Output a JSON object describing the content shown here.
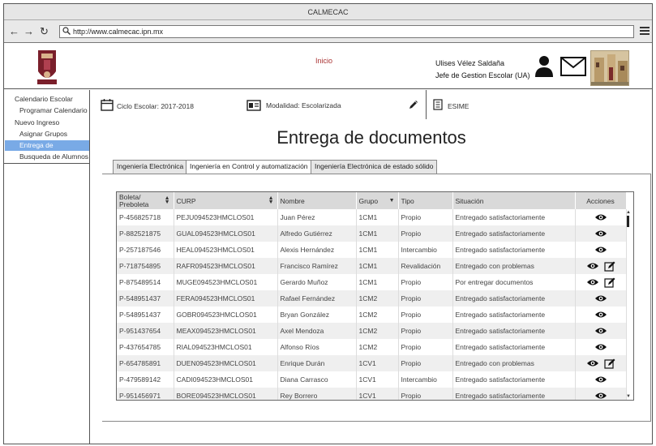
{
  "window": {
    "title": "CALMECAC"
  },
  "browser": {
    "url": "http://www.calmecac.ipn.mx"
  },
  "header": {
    "home_link": "Inicio",
    "user_name": "Ulises Vélez Saldaña",
    "user_role": "Jefe de Gestion Escolar (UA)"
  },
  "sidebar": {
    "items": [
      {
        "label": "Calendario Escolar",
        "active": false
      },
      {
        "label": "Programar Calendario",
        "active": false
      },
      {
        "label": "Nuevo Ingreso",
        "active": false
      },
      {
        "label": "Asignar Grupos",
        "active": false
      },
      {
        "label": "Entrega de",
        "active": true
      },
      {
        "label": "Busqueda de Alumnos",
        "active": false
      }
    ]
  },
  "info": {
    "ciclo": "Ciclo Escolar: 2017-2018",
    "modalidad": "Modalidad: Escolarizada",
    "escuela": "ESIME"
  },
  "page_title": "Entrega de documentos",
  "tabs": [
    {
      "label": "Ingeniería Electrónica",
      "active": false
    },
    {
      "label": "Ingeniería en Control y automatización",
      "active": true
    },
    {
      "label": "Ingeniería Electrónica de estado sólido",
      "active": false
    }
  ],
  "table": {
    "headers": [
      "Boleta/ Preboleta",
      "CURP",
      "Nombre",
      "Grupo",
      "Tipo",
      "Situación",
      "Acciones"
    ],
    "rows": [
      {
        "boleta": "P-456825718",
        "curp": "PEJU094523HMCLOS01",
        "nombre": "Juan Pérez",
        "grupo": "1CM1",
        "tipo": "Propio",
        "situacion": "Entregado satisfactoriamente",
        "edit": false
      },
      {
        "boleta": "P-882521875",
        "curp": "GUAL094523HMCLOS01",
        "nombre": "Alfredo Gutiérrez",
        "grupo": "1CM1",
        "tipo": "Propio",
        "situacion": "Entregado satisfactoriamente",
        "edit": false
      },
      {
        "boleta": "P-257187546",
        "curp": "HEAL094523HMCLOS01",
        "nombre": "Alexis Hernández",
        "grupo": "1CM1",
        "tipo": "Intercambio",
        "situacion": "Entregado satisfactoriamente",
        "edit": false
      },
      {
        "boleta": "P-718754895",
        "curp": "RAFR094523HMCLOS01",
        "nombre": "Francisco Ramírez",
        "grupo": "1CM1",
        "tipo": "Revalidación",
        "situacion": "Entregado con problemas",
        "edit": true
      },
      {
        "boleta": "P-875489514",
        "curp": "MUGE094523HMCLOS01",
        "nombre": "Gerardo Muñoz",
        "grupo": "1CM1",
        "tipo": "Propio",
        "situacion": "Por entregar documentos",
        "edit": true
      },
      {
        "boleta": "P-548951437",
        "curp": "FERA094523HMCLOS01",
        "nombre": "Rafael Fernández",
        "grupo": "1CM2",
        "tipo": "Propio",
        "situacion": "Entregado satisfactoriamente",
        "edit": false
      },
      {
        "boleta": "P-548951437",
        "curp": "GOBR094523HMCLOS01",
        "nombre": "Bryan González",
        "grupo": "1CM2",
        "tipo": "Propio",
        "situacion": "Entregado satisfactoriamente",
        "edit": false
      },
      {
        "boleta": "P-951437654",
        "curp": "MEAX094523HMCLOS01",
        "nombre": "Axel Mendoza",
        "grupo": "1CM2",
        "tipo": "Propio",
        "situacion": "Entregado satisfactoriamente",
        "edit": false
      },
      {
        "boleta": "P-437654785",
        "curp": "RIAL094523HMCLOS01",
        "nombre": "Alfonso Ríos",
        "grupo": "1CM2",
        "tipo": "Propio",
        "situacion": "Entregado satisfactoriamente",
        "edit": false
      },
      {
        "boleta": "P-654785891",
        "curp": "DUEN094523HMCLOS01",
        "nombre": "Enrique Durán",
        "grupo": "1CV1",
        "tipo": "Propio",
        "situacion": "Entregado con problemas",
        "edit": true
      },
      {
        "boleta": "P-479589142",
        "curp": "CADI094523HMCLOS01",
        "nombre": "Diana Carrasco",
        "grupo": "1CV1",
        "tipo": "Intercambio",
        "situacion": "Entregado satisfactoriamente",
        "edit": false
      },
      {
        "boleta": "P-951456971",
        "curp": "BORE094523HMCLOS01",
        "nombre": "Rey Borrero",
        "grupo": "1CV1",
        "tipo": "Propio",
        "situacion": "Entregado satisfactoriamente",
        "edit": false
      }
    ]
  },
  "colors": {
    "active_item": "#79aae6",
    "home_link": "#aa3333",
    "table_header": "#d9d9d9"
  }
}
